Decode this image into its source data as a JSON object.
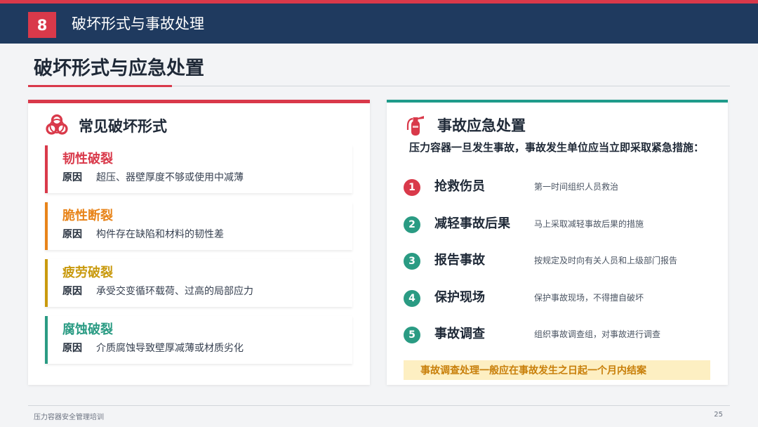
{
  "header": {
    "section_number": "8",
    "section_title": "破坏形式与事故处理"
  },
  "page_title": "破坏形式与应急处置",
  "left_panel": {
    "title": "常见破坏形式",
    "icon": "biohazard-icon",
    "reason_label": "原因",
    "items": [
      {
        "name": "韧性破裂",
        "reason": "超压、器壁厚度不够或使用中减薄",
        "color": "#d9394a"
      },
      {
        "name": "脆性断裂",
        "reason": "构件存在缺陷和材料的韧性差",
        "color": "#e8841a"
      },
      {
        "name": "疲劳破裂",
        "reason": "承受交变循环载荷、过高的局部应力",
        "color": "#c99a0e"
      },
      {
        "name": "腐蚀破裂",
        "reason": "介质腐蚀导致壁厚减薄或材质劣化",
        "color": "#2a9b83"
      }
    ]
  },
  "right_panel": {
    "title": "事故应急处置",
    "icon": "fire-extinguisher-icon",
    "intro": "压力容器一旦发生事故，事故发生单位应当立即采取紧急措施：",
    "steps": [
      {
        "num": "1",
        "name": "抢救伤员",
        "desc": "第一时间组织人员救治",
        "color": "#d9394a"
      },
      {
        "num": "2",
        "name": "减轻事故后果",
        "desc": "马上采取减轻事故后果的措施",
        "color": "#2a9b83"
      },
      {
        "num": "3",
        "name": "报告事故",
        "desc": "按规定及时向有关人员和上级部门报告",
        "color": "#2a9b83"
      },
      {
        "num": "4",
        "name": "保护现场",
        "desc": "保护事故现场，不得擅自破坏",
        "color": "#2a9b83"
      },
      {
        "num": "5",
        "name": "事故调查",
        "desc": "组织事故调查组，对事故进行调查",
        "color": "#2a9b83"
      }
    ],
    "note": "事故调查处理一般应在事故发生之日起一个月内结案"
  },
  "footer": {
    "left": "压力容器安全管理培训",
    "page": "25"
  },
  "colors": {
    "navy": "#1f3a5f",
    "accent_red": "#d9394a",
    "teal": "#1e9b8a"
  }
}
